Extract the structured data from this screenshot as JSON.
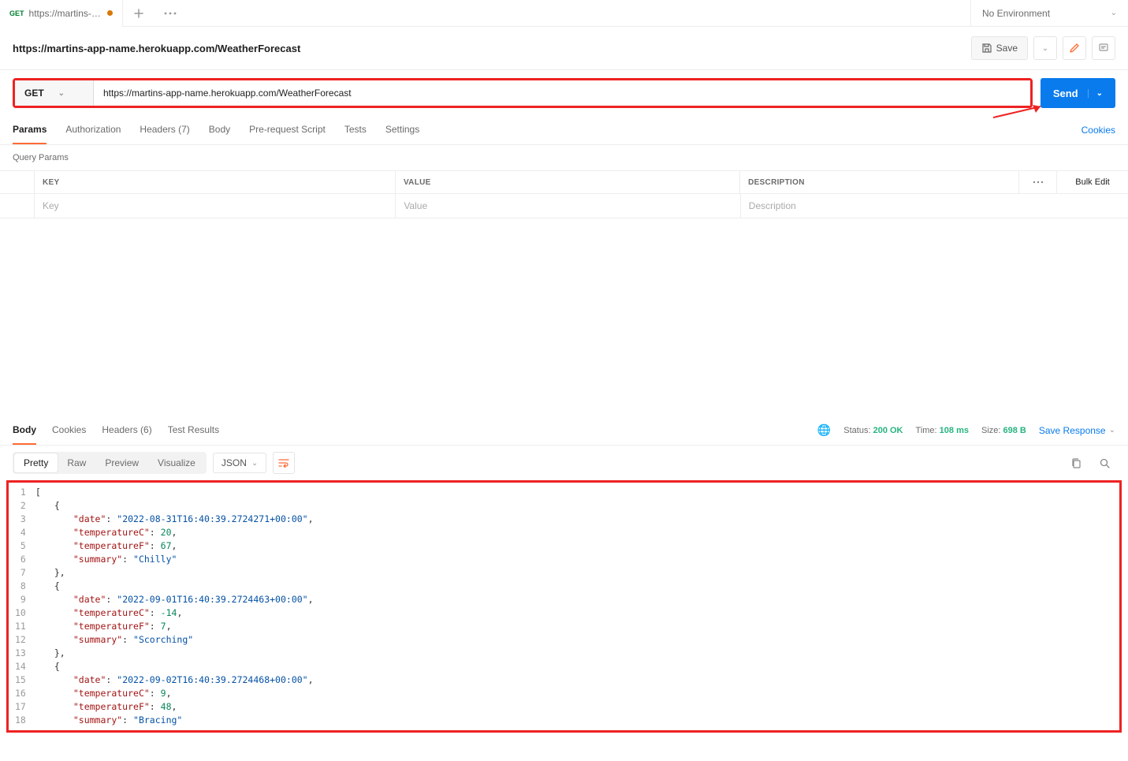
{
  "tab": {
    "method": "GET",
    "title": "https://martins-app-na",
    "unsaved": true
  },
  "env": {
    "label": "No Environment"
  },
  "request": {
    "title": "https://martins-app-name.herokuapp.com/WeatherForecast",
    "method": "GET",
    "url": "https://martins-app-name.herokuapp.com/WeatherForecast"
  },
  "actions": {
    "save": "Save",
    "send": "Send",
    "cookies": "Cookies",
    "saveResponse": "Save Response"
  },
  "reqTabs": {
    "params": "Params",
    "authorization": "Authorization",
    "headers": "Headers (7)",
    "body": "Body",
    "prerequest": "Pre-request Script",
    "tests": "Tests",
    "settings": "Settings"
  },
  "queryParams": {
    "title": "Query Params",
    "headers": {
      "key": "KEY",
      "value": "VALUE",
      "description": "DESCRIPTION",
      "bulk": "Bulk Edit"
    },
    "placeholders": {
      "key": "Key",
      "value": "Value",
      "description": "Description"
    }
  },
  "respTabs": {
    "body": "Body",
    "cookies": "Cookies",
    "headers": "Headers (6)",
    "testResults": "Test Results"
  },
  "respMeta": {
    "statusLabel": "Status:",
    "statusValue": "200 OK",
    "timeLabel": "Time:",
    "timeValue": "108 ms",
    "sizeLabel": "Size:",
    "sizeValue": "698 B"
  },
  "bodyToolbar": {
    "pretty": "Pretty",
    "raw": "Raw",
    "preview": "Preview",
    "visualize": "Visualize",
    "lang": "JSON"
  },
  "response": [
    {
      "date": "2022-08-31T16:40:39.2724271+00:00",
      "temperatureC": 20,
      "temperatureF": 67,
      "summary": "Chilly"
    },
    {
      "date": "2022-09-01T16:40:39.2724463+00:00",
      "temperatureC": -14,
      "temperatureF": 7,
      "summary": "Scorching"
    },
    {
      "date": "2022-09-02T16:40:39.2724468+00:00",
      "temperatureC": 9,
      "temperatureF": 48,
      "summary": "Bracing"
    }
  ]
}
